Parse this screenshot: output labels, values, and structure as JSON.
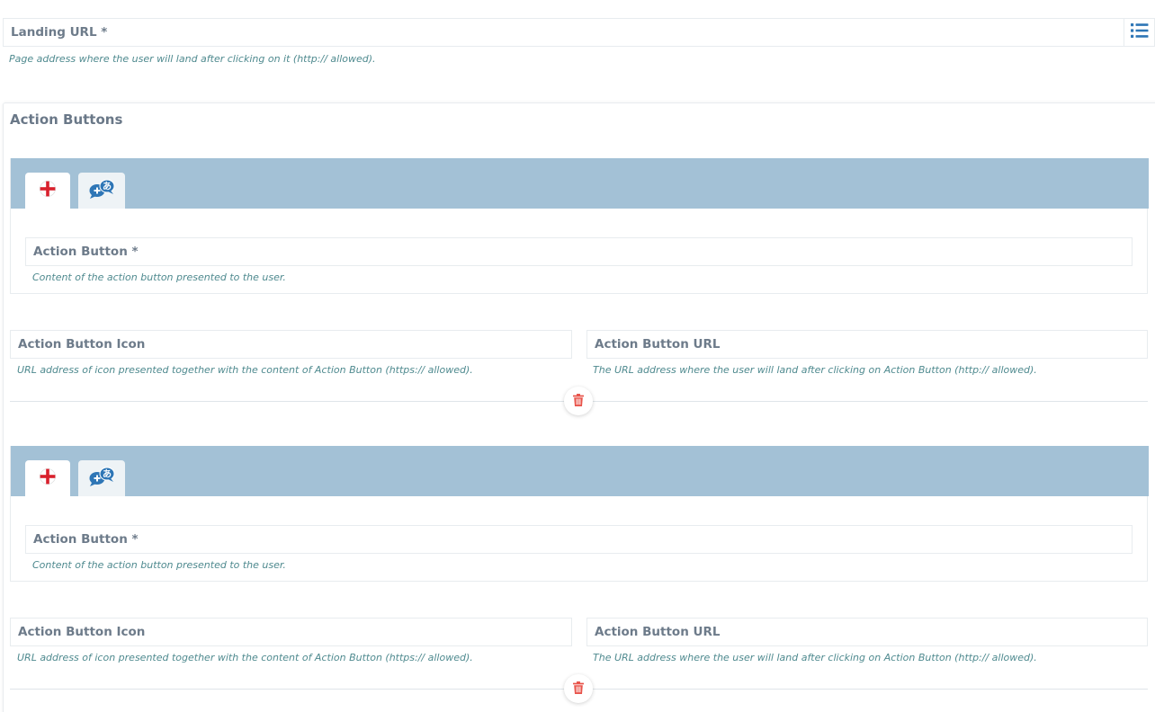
{
  "landing": {
    "label": "Landing URL *",
    "help": "Page address where the user will land after clicking on it (http:// allowed)."
  },
  "section": {
    "title": "Action Buttons"
  },
  "action_buttons": [
    {
      "button_label": "Action Button *",
      "button_help": "Content of the action button presented to the user.",
      "icon_label": "Action Button Icon",
      "icon_help": "URL address of icon presented together with the content of Action Button (https:// allowed).",
      "url_label": "Action Button URL",
      "url_help": "The URL address where the user will land after clicking on Action Button (http:// allowed)."
    },
    {
      "button_label": "Action Button *",
      "button_help": "Content of the action button presented to the user.",
      "icon_label": "Action Button Icon",
      "icon_help": "URL address of icon presented together with the content of Action Button (https:// allowed).",
      "url_label": "Action Button URL",
      "url_help": "The URL address where the user will land after clicking on Action Button (http:// allowed)."
    }
  ],
  "icons": {
    "list": "list-icon",
    "flag": "england-flag-icon",
    "add_language": "add-translation-icon",
    "delete": "trash-icon"
  },
  "colors": {
    "tab_bar": "#a3c1d6",
    "help_text": "#4f8a8f",
    "delete": "#e8534a",
    "icon_blue": "#2e76b6"
  }
}
